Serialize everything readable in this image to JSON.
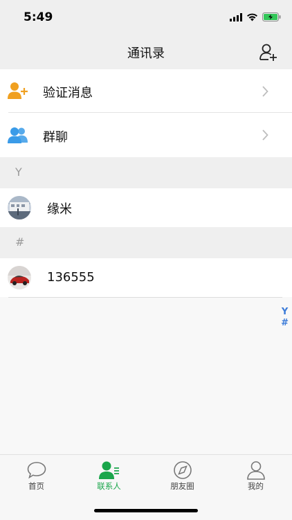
{
  "status": {
    "time": "5:49"
  },
  "nav": {
    "title": "通讯录"
  },
  "entries": [
    {
      "label": "验证消息",
      "icon": "user-add-icon"
    },
    {
      "label": "群聊",
      "icon": "group-icon"
    }
  ],
  "sections": [
    {
      "header": "Y",
      "contacts": [
        {
          "name": "缘米"
        }
      ]
    },
    {
      "header": "#",
      "contacts": [
        {
          "name": "136555"
        }
      ]
    }
  ],
  "index": [
    "Y",
    "#"
  ],
  "tabs": [
    {
      "label": "首页",
      "icon": "chat-bubble-icon"
    },
    {
      "label": "联系人",
      "icon": "contacts-icon",
      "active": true
    },
    {
      "label": "朋友圈",
      "icon": "compass-icon"
    },
    {
      "label": "我的",
      "icon": "person-icon"
    }
  ],
  "colors": {
    "accent": "#1aa64b",
    "orange_icon": "#f0a020",
    "blue_icon": "#3a9be8",
    "index_blue": "#3b7bd8"
  }
}
